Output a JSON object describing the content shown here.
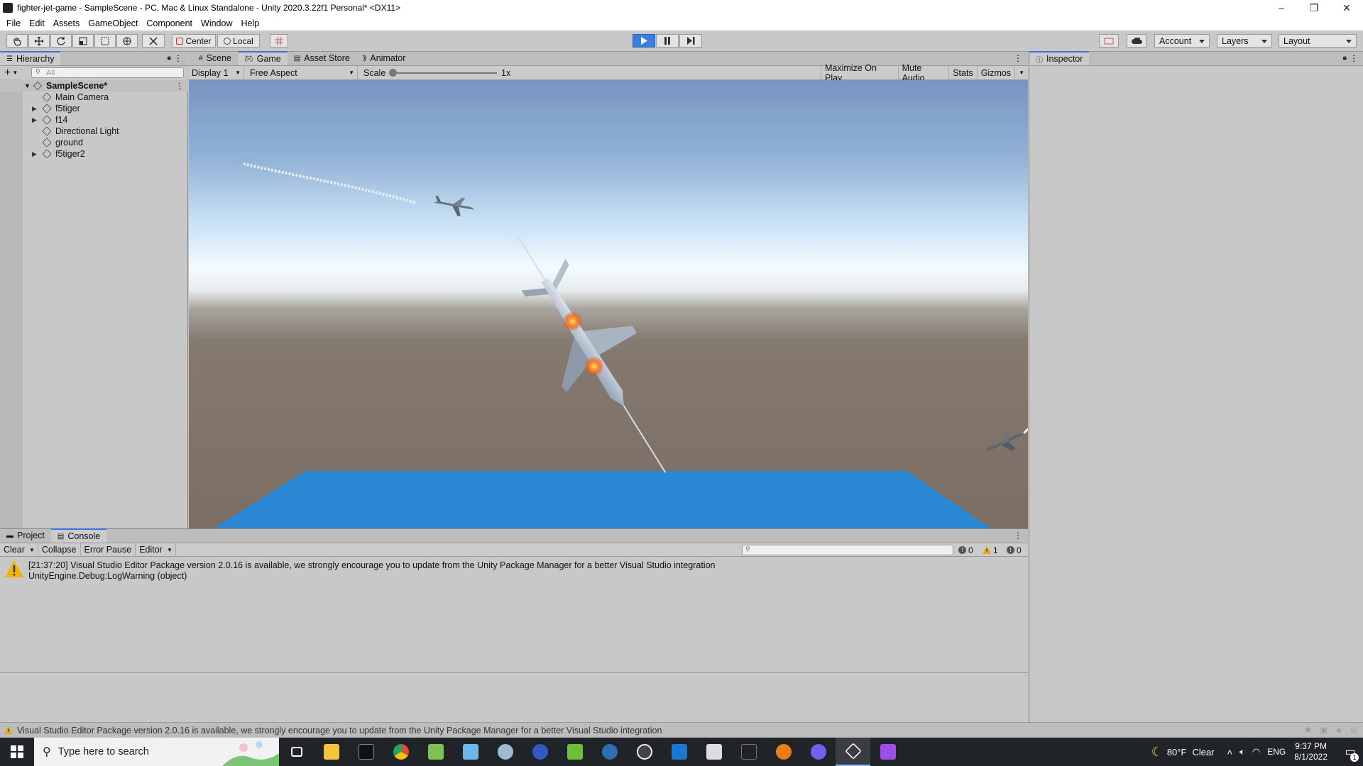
{
  "titlebar": {
    "title": "fighter-jet-game - SampleScene - PC, Mac & Linux Standalone - Unity 2020.3.22f1 Personal* <DX11>",
    "minimize": "–",
    "maximize": "❐",
    "close": "✕"
  },
  "menu": [
    "File",
    "Edit",
    "Assets",
    "GameObject",
    "Component",
    "Window",
    "Help"
  ],
  "toolbar": {
    "pivot_label": "Center",
    "space_label": "Local",
    "account_label": "Account",
    "layers_label": "Layers",
    "layout_label": "Layout",
    "play_active": true
  },
  "hierarchy": {
    "tab_label": "Hierarchy",
    "search_placeholder": "All",
    "add_label": "+",
    "scene_name": "SampleScene*",
    "items": [
      {
        "label": "Main Camera",
        "expandable": false
      },
      {
        "label": "f5tiger",
        "expandable": true
      },
      {
        "label": "f14",
        "expandable": true
      },
      {
        "label": "Directional Light",
        "expandable": false
      },
      {
        "label": "ground",
        "expandable": false
      },
      {
        "label": "f5tiger2",
        "expandable": true
      }
    ]
  },
  "center_tabs": [
    "Scene",
    "Game",
    "Asset Store",
    "Animator"
  ],
  "selected_center_tab": "Game",
  "game": {
    "display": "Display 1",
    "aspect": "Free Aspect",
    "scale_label": "Scale",
    "scale_value": "1x",
    "maximize_on_play": "Maximize On Play",
    "mute_audio": "Mute Audio",
    "stats": "Stats",
    "gizmos": "Gizmos",
    "water_color": "#2a88d4"
  },
  "inspector": {
    "tab_label": "Inspector"
  },
  "bottom_tabs": [
    "Project",
    "Console"
  ],
  "selected_bottom_tab": "Console",
  "console": {
    "clear": "Clear",
    "collapse": "Collapse",
    "error_pause": "Error Pause",
    "editor": "Editor",
    "log_count": "0",
    "warning_count": "1",
    "error_count": "0",
    "entries": [
      {
        "line1": "[21:37:20] Visual Studio Editor Package version 2.0.16 is available, we strongly encourage you to update from the Unity Package Manager for a better Visual Studio integration",
        "line2": "UnityEngine.Debug:LogWarning (object)"
      }
    ]
  },
  "statusbar": {
    "message": "Visual Studio Editor Package version 2.0.16 is available, we strongly encourage you to update from the Unity Package Manager for a better Visual Studio integration"
  },
  "taskbar": {
    "search_placeholder": "Type here to search",
    "apps": [
      {
        "name": "task-view-icon",
        "color": "#ffffff"
      },
      {
        "name": "file-explorer-icon",
        "color": "#f2c53d"
      },
      {
        "name": "terminal-icon",
        "color": "#111111"
      },
      {
        "name": "chrome-icon",
        "color": "#dd4b39"
      },
      {
        "name": "notepad-icon",
        "color": "#7cc24e"
      },
      {
        "name": "paint-icon",
        "color": "#6fb6e8"
      },
      {
        "name": "inkscape-icon",
        "color": "#9fb9d6"
      },
      {
        "name": "krita-icon",
        "color": "#3257c7"
      },
      {
        "name": "audio-app-icon",
        "color": "#6cbf3a"
      },
      {
        "name": "musescore-icon",
        "color": "#2d6eb6"
      },
      {
        "name": "obs-icon",
        "color": "#444444"
      },
      {
        "name": "mail-icon",
        "color": "#1b78d0"
      },
      {
        "name": "calculator-icon",
        "color": "#dddddd"
      },
      {
        "name": "console-app-icon",
        "color": "#222222"
      },
      {
        "name": "blender-icon",
        "color": "#f07d13"
      },
      {
        "name": "viber-icon",
        "color": "#7360f2"
      },
      {
        "name": "unity-icon",
        "color": "#ffffff"
      },
      {
        "name": "visual-studio-icon",
        "color": "#9b4fe8"
      }
    ],
    "weather_temp": "80°F",
    "weather_desc": "Clear",
    "language": "ENG",
    "time": "9:37 PM",
    "date": "8/1/2022",
    "notifications": "1"
  }
}
